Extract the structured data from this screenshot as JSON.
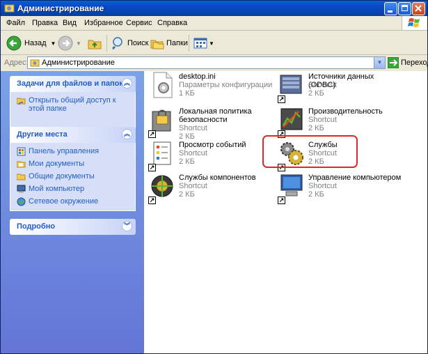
{
  "window": {
    "title": "Администрирование"
  },
  "menu": [
    "Файл",
    "Правка",
    "Вид",
    "Избранное",
    "Сервис",
    "Справка"
  ],
  "toolbar": {
    "back": "Назад",
    "search": "Поиск",
    "folders": "Папки"
  },
  "address": {
    "label": "Адрес:",
    "value": "Администрирование",
    "go": "Переход"
  },
  "tasks": {
    "title": "Задачи для файлов и папок",
    "items": [
      {
        "label": "Открыть общий доступ к этой папке",
        "icon": "share-folder-icon"
      }
    ]
  },
  "places": {
    "title": "Другие места",
    "items": [
      {
        "label": "Панель управления",
        "icon": "control-panel-icon"
      },
      {
        "label": "Мои документы",
        "icon": "my-documents-icon"
      },
      {
        "label": "Общие документы",
        "icon": "shared-documents-icon"
      },
      {
        "label": "Мой компьютер",
        "icon": "my-computer-icon"
      },
      {
        "label": "Сетевое окружение",
        "icon": "network-places-icon"
      }
    ]
  },
  "details": {
    "title": "Подробно"
  },
  "files": [
    {
      "name": "desktop.ini",
      "type": "Параметры конфигурации",
      "size": "1 КБ",
      "icon": "settings-file-icon"
    },
    {
      "name": "Источники данных (ODBC)",
      "type": "Shortcut",
      "size": "2 КБ",
      "icon": "odbc-icon"
    },
    {
      "name": "Локальная политика безопасности",
      "type": "Shortcut",
      "size": "2 КБ",
      "icon": "security-policy-icon"
    },
    {
      "name": "Производительность",
      "type": "Shortcut",
      "size": "2 КБ",
      "icon": "performance-icon"
    },
    {
      "name": "Просмотр событий",
      "type": "Shortcut",
      "size": "2 КБ",
      "icon": "event-viewer-icon"
    },
    {
      "name": "Службы",
      "type": "Shortcut",
      "size": "2 КБ",
      "icon": "services-icon"
    },
    {
      "name": "Службы компонентов",
      "type": "Shortcut",
      "size": "2 КБ",
      "icon": "component-services-icon"
    },
    {
      "name": "Управление компьютером",
      "type": "Shortcut",
      "size": "2 КБ",
      "icon": "computer-management-icon"
    }
  ],
  "colors": {
    "titlebar": "#0848c0",
    "taskpane_link": "#215dc6",
    "highlight": "#e0262d"
  }
}
